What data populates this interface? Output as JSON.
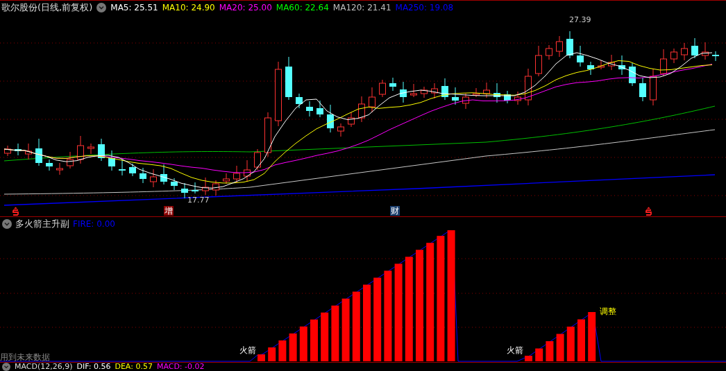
{
  "main_panel": {
    "title": "歌尔股份(日线,前复权)",
    "indicators": [
      {
        "label": "MA5: 25.51",
        "color": "#ffffff"
      },
      {
        "label": "MA10: 24.90",
        "color": "#ffff00"
      },
      {
        "label": "MA20: 25.00",
        "color": "#ff00ff"
      },
      {
        "label": "MA60: 22.64",
        "color": "#00ff00"
      },
      {
        "label": "MA120: 21.41",
        "color": "#c0c0c0"
      },
      {
        "label": "MA250: 19.08",
        "color": "#0000ff"
      }
    ],
    "high_label": "27.39",
    "low_label": "17.77",
    "event_markers": [
      {
        "kind": "s-icon"
      },
      {
        "kind": "label",
        "label": "增",
        "color": "#8b0000"
      },
      {
        "kind": "label",
        "label": "财",
        "color": "#1c3f6e"
      },
      {
        "kind": "s-icon"
      }
    ]
  },
  "indicator_panel": {
    "title": "多火箭主升副",
    "readout": "FIRE: 0.00",
    "signals": [
      {
        "label": "火箭",
        "kind": "start"
      },
      {
        "label": "火箭",
        "kind": "start"
      },
      {
        "label": "调整",
        "kind": "end"
      }
    ],
    "note": "用到未来数据"
  },
  "macd_panel": {
    "title": "MACD(12,26,9)",
    "readouts": [
      {
        "label": "DIF: 0.56",
        "color": "#ffffff"
      },
      {
        "label": "DEA: 0.57",
        "color": "#ffff00"
      },
      {
        "label": "MACD: -0.02",
        "color": "#ff00ff"
      }
    ]
  }
}
